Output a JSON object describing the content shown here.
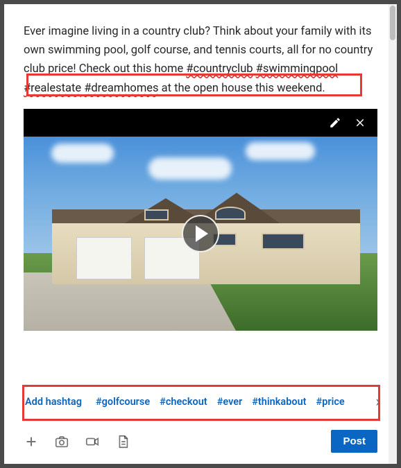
{
  "post": {
    "text_before": "Ever imagine living in a country club? Think about your family with its own swimming pool, golf course, and tennis courts, all for no country club price! Check out this home ",
    "hashtags_inline": [
      "#countryclub",
      "#swimmingpool",
      "#realestate",
      "#dreamhomes"
    ],
    "text_after": " at the open house this weekend."
  },
  "media": {
    "edit_label": "Edit",
    "remove_label": "Remove",
    "play_label": "Play video"
  },
  "hashtags": {
    "add_label": "Add hashtag",
    "suggestions": [
      "#golfcourse",
      "#checkout",
      "#ever",
      "#thinkabout",
      "#price"
    ]
  },
  "toolbar": {
    "add_more_label": "Add",
    "photo_label": "Photo",
    "video_label": "Video",
    "document_label": "Document",
    "post_label": "Post"
  }
}
